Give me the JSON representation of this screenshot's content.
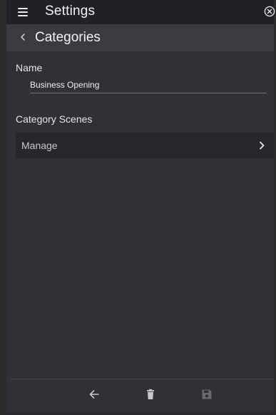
{
  "header": {
    "title": "Settings",
    "menu_icon": "hamburger-menu-icon",
    "close_icon": "close-circle-icon"
  },
  "subheader": {
    "title": "Categories",
    "back_icon": "chevron-left-icon"
  },
  "form": {
    "name_label": "Name",
    "name_value": "Business Opening",
    "scenes_label": "Category Scenes",
    "manage_label": "Manage",
    "manage_icon": "chevron-right-icon"
  },
  "toolbar": {
    "back_icon": "arrow-left-icon",
    "delete_icon": "trash-icon",
    "save_icon": "save-floppy-icon",
    "save_enabled": false
  },
  "colors": {
    "topbar": "#202124",
    "subheader": "#3a3b3f",
    "background": "#303134",
    "row": "#26272a",
    "text": "#e6e6e6",
    "disabled": "#6a6b6f"
  }
}
